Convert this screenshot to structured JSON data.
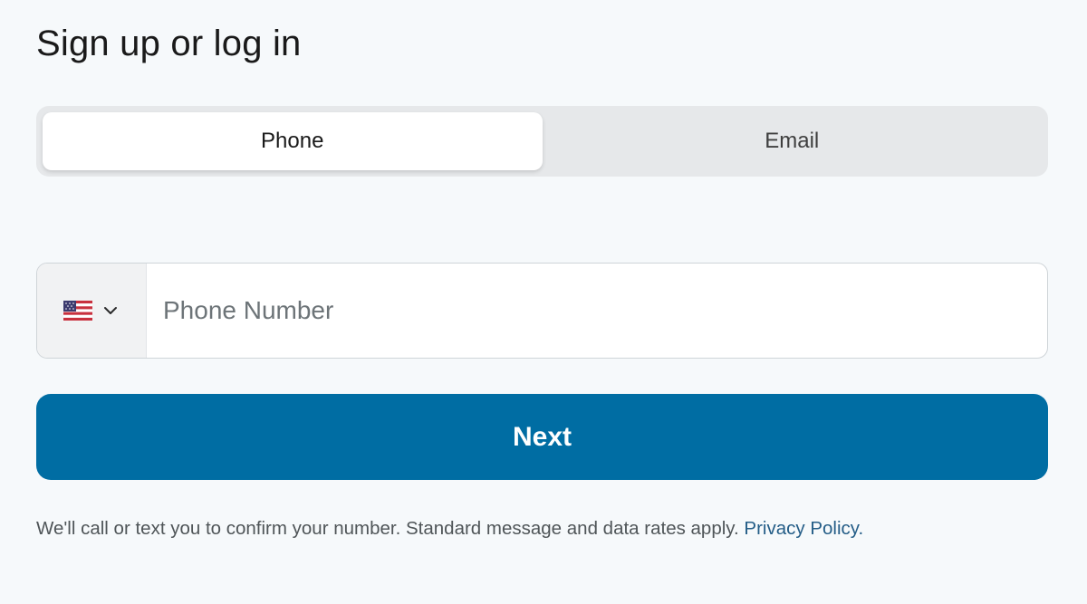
{
  "header": {
    "title": "Sign up or log in"
  },
  "tabs": {
    "items": [
      {
        "label": "Phone",
        "active": true
      },
      {
        "label": "Email",
        "active": false
      }
    ]
  },
  "phone_form": {
    "country_flag_icon": "us-flag-icon",
    "dropdown_icon": "chevron-down-icon",
    "placeholder": "Phone Number",
    "value": ""
  },
  "actions": {
    "next_label": "Next"
  },
  "footer": {
    "disclaimer_text": "We'll call or text you to confirm your number. Standard message and data rates apply.",
    "privacy_link_label": "Privacy Policy",
    "trailing_period": "."
  },
  "colors": {
    "primary_button": "#006da3",
    "link": "#245d87",
    "background": "#f6f9fb"
  }
}
